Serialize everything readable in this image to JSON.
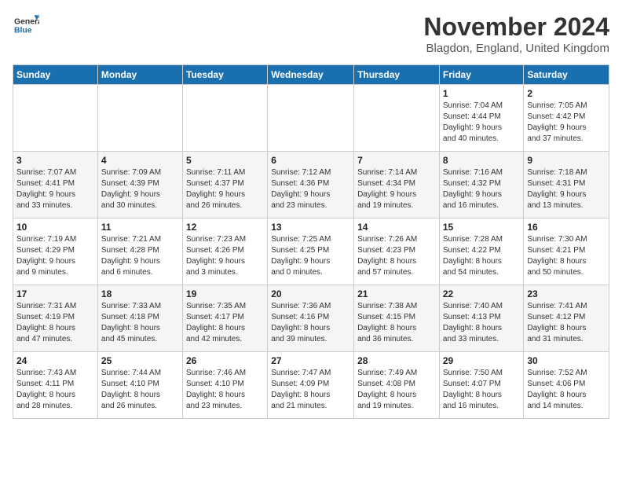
{
  "logo": {
    "general": "General",
    "blue": "Blue"
  },
  "title": "November 2024",
  "location": "Blagdon, England, United Kingdom",
  "headers": [
    "Sunday",
    "Monday",
    "Tuesday",
    "Wednesday",
    "Thursday",
    "Friday",
    "Saturday"
  ],
  "weeks": [
    [
      {
        "day": "",
        "info": ""
      },
      {
        "day": "",
        "info": ""
      },
      {
        "day": "",
        "info": ""
      },
      {
        "day": "",
        "info": ""
      },
      {
        "day": "",
        "info": ""
      },
      {
        "day": "1",
        "info": "Sunrise: 7:04 AM\nSunset: 4:44 PM\nDaylight: 9 hours\nand 40 minutes."
      },
      {
        "day": "2",
        "info": "Sunrise: 7:05 AM\nSunset: 4:42 PM\nDaylight: 9 hours\nand 37 minutes."
      }
    ],
    [
      {
        "day": "3",
        "info": "Sunrise: 7:07 AM\nSunset: 4:41 PM\nDaylight: 9 hours\nand 33 minutes."
      },
      {
        "day": "4",
        "info": "Sunrise: 7:09 AM\nSunset: 4:39 PM\nDaylight: 9 hours\nand 30 minutes."
      },
      {
        "day": "5",
        "info": "Sunrise: 7:11 AM\nSunset: 4:37 PM\nDaylight: 9 hours\nand 26 minutes."
      },
      {
        "day": "6",
        "info": "Sunrise: 7:12 AM\nSunset: 4:36 PM\nDaylight: 9 hours\nand 23 minutes."
      },
      {
        "day": "7",
        "info": "Sunrise: 7:14 AM\nSunset: 4:34 PM\nDaylight: 9 hours\nand 19 minutes."
      },
      {
        "day": "8",
        "info": "Sunrise: 7:16 AM\nSunset: 4:32 PM\nDaylight: 9 hours\nand 16 minutes."
      },
      {
        "day": "9",
        "info": "Sunrise: 7:18 AM\nSunset: 4:31 PM\nDaylight: 9 hours\nand 13 minutes."
      }
    ],
    [
      {
        "day": "10",
        "info": "Sunrise: 7:19 AM\nSunset: 4:29 PM\nDaylight: 9 hours\nand 9 minutes."
      },
      {
        "day": "11",
        "info": "Sunrise: 7:21 AM\nSunset: 4:28 PM\nDaylight: 9 hours\nand 6 minutes."
      },
      {
        "day": "12",
        "info": "Sunrise: 7:23 AM\nSunset: 4:26 PM\nDaylight: 9 hours\nand 3 minutes."
      },
      {
        "day": "13",
        "info": "Sunrise: 7:25 AM\nSunset: 4:25 PM\nDaylight: 9 hours\nand 0 minutes."
      },
      {
        "day": "14",
        "info": "Sunrise: 7:26 AM\nSunset: 4:23 PM\nDaylight: 8 hours\nand 57 minutes."
      },
      {
        "day": "15",
        "info": "Sunrise: 7:28 AM\nSunset: 4:22 PM\nDaylight: 8 hours\nand 54 minutes."
      },
      {
        "day": "16",
        "info": "Sunrise: 7:30 AM\nSunset: 4:21 PM\nDaylight: 8 hours\nand 50 minutes."
      }
    ],
    [
      {
        "day": "17",
        "info": "Sunrise: 7:31 AM\nSunset: 4:19 PM\nDaylight: 8 hours\nand 47 minutes."
      },
      {
        "day": "18",
        "info": "Sunrise: 7:33 AM\nSunset: 4:18 PM\nDaylight: 8 hours\nand 45 minutes."
      },
      {
        "day": "19",
        "info": "Sunrise: 7:35 AM\nSunset: 4:17 PM\nDaylight: 8 hours\nand 42 minutes."
      },
      {
        "day": "20",
        "info": "Sunrise: 7:36 AM\nSunset: 4:16 PM\nDaylight: 8 hours\nand 39 minutes."
      },
      {
        "day": "21",
        "info": "Sunrise: 7:38 AM\nSunset: 4:15 PM\nDaylight: 8 hours\nand 36 minutes."
      },
      {
        "day": "22",
        "info": "Sunrise: 7:40 AM\nSunset: 4:13 PM\nDaylight: 8 hours\nand 33 minutes."
      },
      {
        "day": "23",
        "info": "Sunrise: 7:41 AM\nSunset: 4:12 PM\nDaylight: 8 hours\nand 31 minutes."
      }
    ],
    [
      {
        "day": "24",
        "info": "Sunrise: 7:43 AM\nSunset: 4:11 PM\nDaylight: 8 hours\nand 28 minutes."
      },
      {
        "day": "25",
        "info": "Sunrise: 7:44 AM\nSunset: 4:10 PM\nDaylight: 8 hours\nand 26 minutes."
      },
      {
        "day": "26",
        "info": "Sunrise: 7:46 AM\nSunset: 4:10 PM\nDaylight: 8 hours\nand 23 minutes."
      },
      {
        "day": "27",
        "info": "Sunrise: 7:47 AM\nSunset: 4:09 PM\nDaylight: 8 hours\nand 21 minutes."
      },
      {
        "day": "28",
        "info": "Sunrise: 7:49 AM\nSunset: 4:08 PM\nDaylight: 8 hours\nand 19 minutes."
      },
      {
        "day": "29",
        "info": "Sunrise: 7:50 AM\nSunset: 4:07 PM\nDaylight: 8 hours\nand 16 minutes."
      },
      {
        "day": "30",
        "info": "Sunrise: 7:52 AM\nSunset: 4:06 PM\nDaylight: 8 hours\nand 14 minutes."
      }
    ]
  ]
}
